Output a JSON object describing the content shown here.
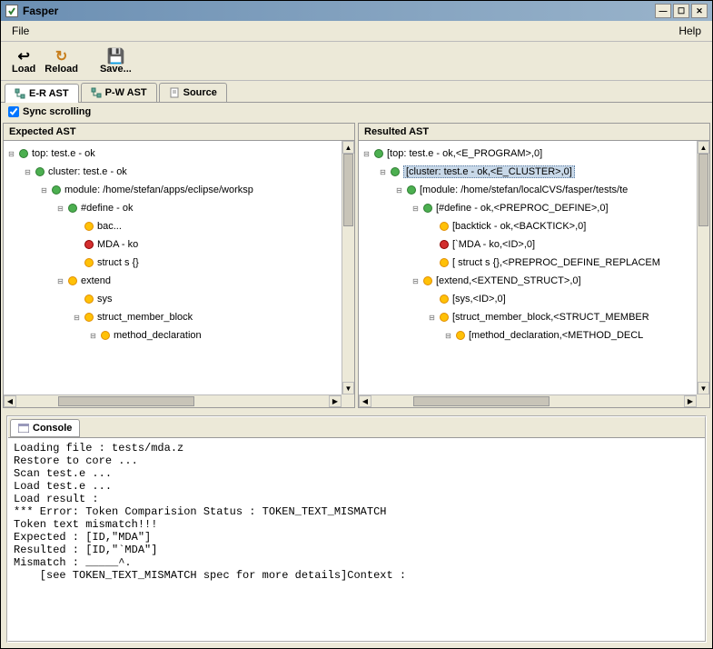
{
  "window": {
    "title": "Fasper"
  },
  "menubar": {
    "file": "File",
    "help": "Help"
  },
  "toolbar": {
    "load": "Load",
    "reload": "Reload",
    "save": "Save..."
  },
  "tabs": {
    "er": "E-R AST",
    "pw": "P-W AST",
    "source": "Source"
  },
  "sync": {
    "label": "Sync scrolling"
  },
  "expected": {
    "title": "Expected AST",
    "nodes": [
      {
        "indent": 0,
        "toggle": "−",
        "icon": "green",
        "label": "top: test.e - ok"
      },
      {
        "indent": 1,
        "toggle": "−",
        "icon": "green",
        "label": "cluster: test.e - ok"
      },
      {
        "indent": 2,
        "toggle": "−",
        "icon": "green",
        "label": "module: /home/stefan/apps/eclipse/worksp"
      },
      {
        "indent": 3,
        "toggle": "−",
        "icon": "green",
        "label": "#define - ok"
      },
      {
        "indent": 4,
        "toggle": "",
        "icon": "yellow",
        "label": "bac..."
      },
      {
        "indent": 4,
        "toggle": "",
        "icon": "red",
        "label": "MDA - ko"
      },
      {
        "indent": 4,
        "toggle": "",
        "icon": "yellow",
        "label": "struct s {}"
      },
      {
        "indent": 3,
        "toggle": "−",
        "icon": "yellow",
        "label": "extend"
      },
      {
        "indent": 4,
        "toggle": "",
        "icon": "yellow",
        "label": "sys"
      },
      {
        "indent": 4,
        "toggle": "−",
        "icon": "yellow",
        "label": "struct_member_block"
      },
      {
        "indent": 5,
        "toggle": "−",
        "icon": "yellow",
        "label": "method_declaration"
      }
    ]
  },
  "resulted": {
    "title": "Resulted AST",
    "nodes": [
      {
        "indent": 0,
        "toggle": "−",
        "icon": "green",
        "label": "[top: test.e - ok,<E_PROGRAM>,0]",
        "selected": false
      },
      {
        "indent": 1,
        "toggle": "−",
        "icon": "green",
        "label": "[cluster: test.e - ok,<E_CLUSTER>,0]",
        "selected": true
      },
      {
        "indent": 2,
        "toggle": "−",
        "icon": "green",
        "label": "[module: /home/stefan/localCVS/fasper/tests/te"
      },
      {
        "indent": 3,
        "toggle": "−",
        "icon": "green",
        "label": "[#define - ok,<PREPROC_DEFINE>,0]"
      },
      {
        "indent": 4,
        "toggle": "",
        "icon": "yellow",
        "label": "[backtick - ok,<BACKTICK>,0]"
      },
      {
        "indent": 4,
        "toggle": "",
        "icon": "red",
        "label": "[`MDA - ko,<ID>,0]"
      },
      {
        "indent": 4,
        "toggle": "",
        "icon": "yellow",
        "label": "[ struct s {},<PREPROC_DEFINE_REPLACEM"
      },
      {
        "indent": 3,
        "toggle": "−",
        "icon": "yellow",
        "label": "[extend,<EXTEND_STRUCT>,0]"
      },
      {
        "indent": 4,
        "toggle": "",
        "icon": "yellow",
        "label": "[sys,<ID>,0]"
      },
      {
        "indent": 4,
        "toggle": "−",
        "icon": "yellow",
        "label": "[struct_member_block,<STRUCT_MEMBER"
      },
      {
        "indent": 5,
        "toggle": "−",
        "icon": "yellow",
        "label": "[method_declaration,<METHOD_DECL"
      }
    ]
  },
  "console": {
    "title": "Console",
    "text": "Loading file : tests/mda.z\nRestore to core ...\nScan test.e ...\nLoad test.e ...\nLoad result :\n*** Error: Token Comparision Status : TOKEN_TEXT_MISMATCH\nToken text mismatch!!!\nExpected : [ID,\"MDA\"]\nResulted : [ID,\"`MDA\"]\nMismatch : _____^.\n    [see TOKEN_TEXT_MISMATCH spec for more details]Context :"
  }
}
